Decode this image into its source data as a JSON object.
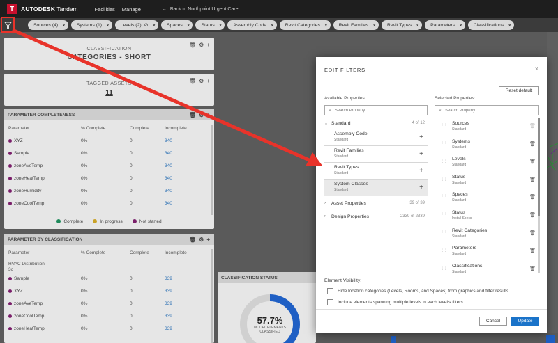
{
  "app": {
    "logo_letter": "T",
    "brand_bold": "AUTODESK",
    "brand_rest": " Tandem",
    "nav": [
      "Facilities",
      "Manage"
    ],
    "back_link": "Back to Northpoint Urgent Care"
  },
  "filter_chips": [
    {
      "label": "Sources (4)",
      "icon": "close"
    },
    {
      "label": "Systems (1)",
      "icon": "close"
    },
    {
      "label": "Levels (2)",
      "icon": "eye-off-close"
    },
    {
      "label": "Spaces",
      "icon": "close"
    },
    {
      "label": "Status",
      "icon": "close"
    },
    {
      "label": "Assembly Code",
      "icon": "close"
    },
    {
      "label": "Revit Categories",
      "icon": "close"
    },
    {
      "label": "Revit Families",
      "icon": "close"
    },
    {
      "label": "Revit Types",
      "icon": "close"
    },
    {
      "label": "Parameters",
      "icon": "close"
    },
    {
      "label": "Classifications",
      "icon": "close"
    }
  ],
  "classification_card": {
    "label": "CLASSIFICATION",
    "title": "CATEGORIES - SHORT"
  },
  "tagged_card": {
    "label": "TAGGED ASSETS",
    "value": "11"
  },
  "parameter_completeness": {
    "title": "PARAMETER COMPLETENESS",
    "columns": [
      "Parameter",
      "% Complete",
      "Complete",
      "Incomplete"
    ],
    "rows": [
      [
        "XYZ",
        "0%",
        "0",
        "340"
      ],
      [
        "Sample",
        "0%",
        "0",
        "340"
      ],
      [
        "zoneAveTemp",
        "0%",
        "0",
        "340"
      ],
      [
        "zoneHeatTemp",
        "0%",
        "0",
        "340"
      ],
      [
        "zoneHumidity",
        "0%",
        "0",
        "340"
      ],
      [
        "zoneCoolTemp",
        "0%",
        "0",
        "340"
      ]
    ],
    "legend": [
      {
        "label": "Complete",
        "color": "#1f8a5b"
      },
      {
        "label": "In progress",
        "color": "#c9a227"
      },
      {
        "label": "Not started",
        "color": "#7a1f6a"
      }
    ]
  },
  "parameter_by_classification": {
    "title": "PARAMETER BY CLASSIFICATION",
    "columns": [
      "Parameter",
      "% Complete",
      "Complete",
      "Incomplete"
    ],
    "group_line1": "HVAC Distribution",
    "group_line2": "3c",
    "rows": [
      [
        "Sample",
        "0%",
        "0",
        "339"
      ],
      [
        "XYZ",
        "0%",
        "0",
        "339"
      ],
      [
        "zoneAveTemp",
        "0%",
        "0",
        "339"
      ],
      [
        "zoneCoolTemp",
        "0%",
        "0",
        "339"
      ],
      [
        "zoneHeatTemp",
        "0%",
        "0",
        "339"
      ]
    ]
  },
  "classification_status": {
    "title": "CLASSIFICATION STATUS",
    "percent": "57.7%",
    "sub1": "MODEL ELEMENTS",
    "sub2": "CLASSIFIED"
  },
  "modal": {
    "title": "EDIT FILTERS",
    "close": "×",
    "available_label": "Available Properties:",
    "selected_label": "Selected Properties:",
    "reset": "Reset default",
    "search_placeholder": "Search Property",
    "standard_group": {
      "label": "Standard",
      "count": "4 of 12"
    },
    "available_items": [
      {
        "name": "Assembly Code",
        "sub": "Standard"
      },
      {
        "name": "Revit Families",
        "sub": "Standard"
      },
      {
        "name": "Revit Types",
        "sub": "Standard"
      },
      {
        "name": "System Classes",
        "sub": "Standard"
      }
    ],
    "asset_group": {
      "label": "Asset Properties",
      "count": "39 of 39"
    },
    "design_group": {
      "label": "Design Properties",
      "count": "2339 of 2339"
    },
    "selected_items": [
      {
        "name": "Sources",
        "sub": "Standard"
      },
      {
        "name": "Systems",
        "sub": "Standard"
      },
      {
        "name": "Levels",
        "sub": "Standard"
      },
      {
        "name": "Status",
        "sub": "Standard"
      },
      {
        "name": "Spaces",
        "sub": "Standard"
      },
      {
        "name": "Status",
        "sub": "Install Specs"
      },
      {
        "name": "Revit Categories",
        "sub": "Standard"
      },
      {
        "name": "Parameters",
        "sub": "Standard"
      },
      {
        "name": "Classifications",
        "sub": "Standard"
      }
    ],
    "visibility_title": "Element Visibility:",
    "visibility_options": [
      "Hide location categories (Levels, Rooms, and Spaces) from graphics and filter results",
      "Include elements spanning multiple levels in each level's filters"
    ],
    "cancel": "Cancel",
    "update": "Update"
  },
  "colors": {
    "annotation_red": "#e8332a",
    "primary_blue": "#1a73c9",
    "brand_red": "#c8102e"
  }
}
